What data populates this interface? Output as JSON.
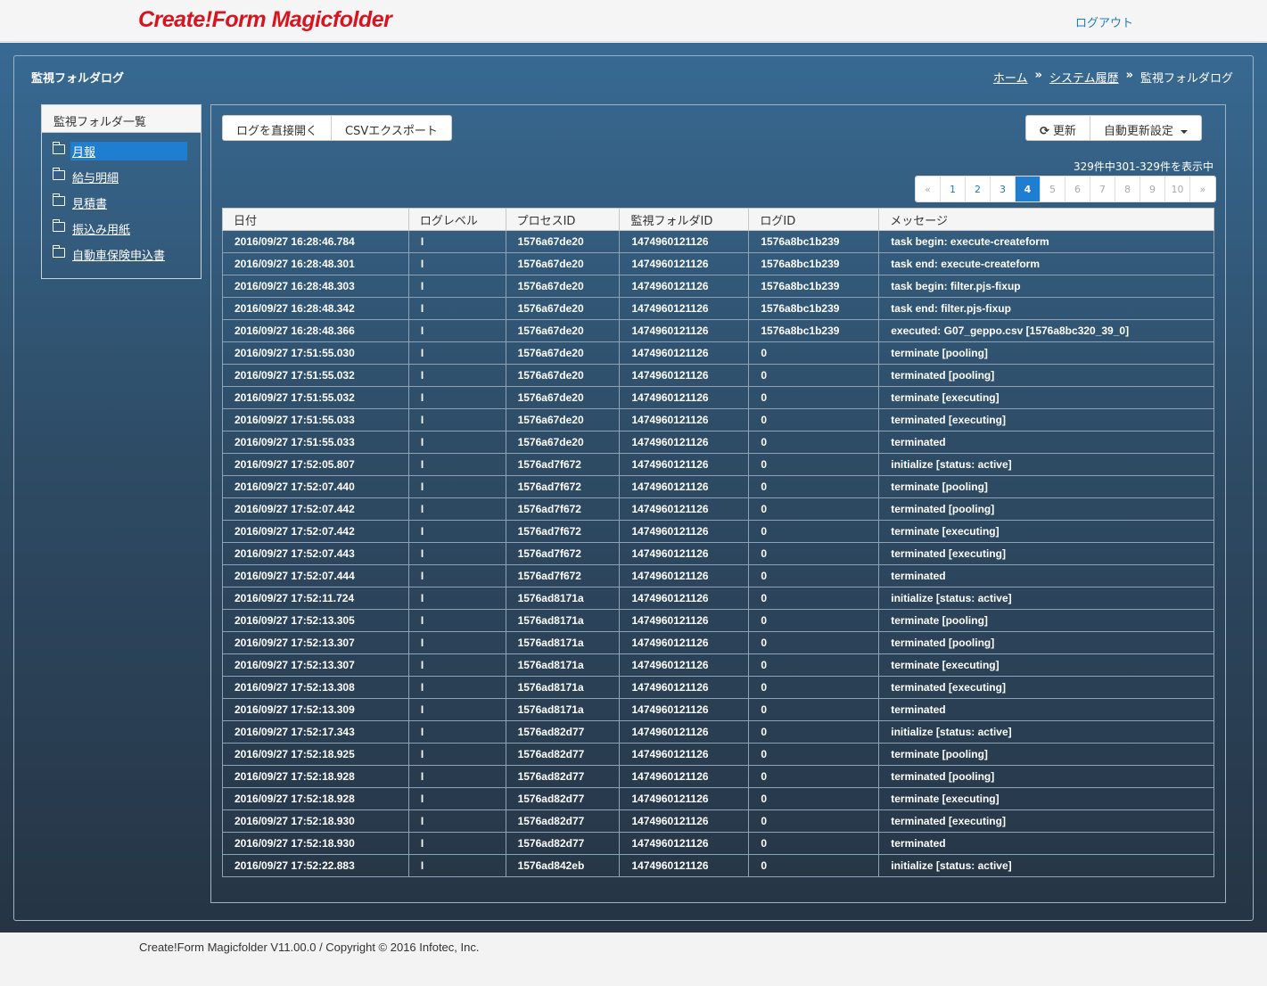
{
  "header": {
    "logo": "Create!Form Magicfolder",
    "logout_label": "ログアウト"
  },
  "page": {
    "title": "監視フォルダログ",
    "breadcrumb": {
      "home": "ホーム",
      "history": "システム履歴",
      "current": "監視フォルダログ",
      "separator": "»"
    }
  },
  "sidebar": {
    "heading": "監視フォルダ一覧",
    "items": [
      {
        "label": "月報",
        "active": true
      },
      {
        "label": "給与明細"
      },
      {
        "label": "見積書"
      },
      {
        "label": "振込み用紙"
      },
      {
        "label": "自動車保険申込書"
      }
    ]
  },
  "toolbar": {
    "open_log_label": "ログを直接開く",
    "csv_export_label": "CSVエクスポート",
    "refresh_label": "更新",
    "auto_refresh_label": "自動更新設定"
  },
  "pagination": {
    "summary": "329件中301-329件を表示中",
    "prev": "«",
    "next": "»",
    "pages": [
      "1",
      "2",
      "3",
      "4",
      "5",
      "6",
      "7",
      "8",
      "9",
      "10"
    ],
    "current": "4"
  },
  "table": {
    "columns": [
      "日付",
      "ログレベル",
      "プロセスID",
      "監視フォルダID",
      "ログID",
      "メッセージ"
    ],
    "rows": [
      [
        "2016/09/27 16:28:46.784",
        "I",
        "1576a67de20",
        "1474960121126",
        "1576a8bc1b239",
        "task begin: execute-createform"
      ],
      [
        "2016/09/27 16:28:48.301",
        "I",
        "1576a67de20",
        "1474960121126",
        "1576a8bc1b239",
        "task end: execute-createform"
      ],
      [
        "2016/09/27 16:28:48.303",
        "I",
        "1576a67de20",
        "1474960121126",
        "1576a8bc1b239",
        "task begin: filter.pjs-fixup"
      ],
      [
        "2016/09/27 16:28:48.342",
        "I",
        "1576a67de20",
        "1474960121126",
        "1576a8bc1b239",
        "task end: filter.pjs-fixup"
      ],
      [
        "2016/09/27 16:28:48.366",
        "I",
        "1576a67de20",
        "1474960121126",
        "1576a8bc1b239",
        "executed: G07_geppo.csv [1576a8bc320_39_0]"
      ],
      [
        "2016/09/27 17:51:55.030",
        "I",
        "1576a67de20",
        "1474960121126",
        "0",
        "terminate [pooling]"
      ],
      [
        "2016/09/27 17:51:55.032",
        "I",
        "1576a67de20",
        "1474960121126",
        "0",
        "terminated [pooling]"
      ],
      [
        "2016/09/27 17:51:55.032",
        "I",
        "1576a67de20",
        "1474960121126",
        "0",
        "terminate [executing]"
      ],
      [
        "2016/09/27 17:51:55.033",
        "I",
        "1576a67de20",
        "1474960121126",
        "0",
        "terminated [executing]"
      ],
      [
        "2016/09/27 17:51:55.033",
        "I",
        "1576a67de20",
        "1474960121126",
        "0",
        "terminated"
      ],
      [
        "2016/09/27 17:52:05.807",
        "I",
        "1576ad7f672",
        "1474960121126",
        "0",
        "initialize [status: active]"
      ],
      [
        "2016/09/27 17:52:07.440",
        "I",
        "1576ad7f672",
        "1474960121126",
        "0",
        "terminate [pooling]"
      ],
      [
        "2016/09/27 17:52:07.442",
        "I",
        "1576ad7f672",
        "1474960121126",
        "0",
        "terminated [pooling]"
      ],
      [
        "2016/09/27 17:52:07.442",
        "I",
        "1576ad7f672",
        "1474960121126",
        "0",
        "terminate [executing]"
      ],
      [
        "2016/09/27 17:52:07.443",
        "I",
        "1576ad7f672",
        "1474960121126",
        "0",
        "terminated [executing]"
      ],
      [
        "2016/09/27 17:52:07.444",
        "I",
        "1576ad7f672",
        "1474960121126",
        "0",
        "terminated"
      ],
      [
        "2016/09/27 17:52:11.724",
        "I",
        "1576ad8171a",
        "1474960121126",
        "0",
        "initialize [status: active]"
      ],
      [
        "2016/09/27 17:52:13.305",
        "I",
        "1576ad8171a",
        "1474960121126",
        "0",
        "terminate [pooling]"
      ],
      [
        "2016/09/27 17:52:13.307",
        "I",
        "1576ad8171a",
        "1474960121126",
        "0",
        "terminated [pooling]"
      ],
      [
        "2016/09/27 17:52:13.307",
        "I",
        "1576ad8171a",
        "1474960121126",
        "0",
        "terminate [executing]"
      ],
      [
        "2016/09/27 17:52:13.308",
        "I",
        "1576ad8171a",
        "1474960121126",
        "0",
        "terminated [executing]"
      ],
      [
        "2016/09/27 17:52:13.309",
        "I",
        "1576ad8171a",
        "1474960121126",
        "0",
        "terminated"
      ],
      [
        "2016/09/27 17:52:17.343",
        "I",
        "1576ad82d77",
        "1474960121126",
        "0",
        "initialize [status: active]"
      ],
      [
        "2016/09/27 17:52:18.925",
        "I",
        "1576ad82d77",
        "1474960121126",
        "0",
        "terminate [pooling]"
      ],
      [
        "2016/09/27 17:52:18.928",
        "I",
        "1576ad82d77",
        "1474960121126",
        "0",
        "terminated [pooling]"
      ],
      [
        "2016/09/27 17:52:18.928",
        "I",
        "1576ad82d77",
        "1474960121126",
        "0",
        "terminate [executing]"
      ],
      [
        "2016/09/27 17:52:18.930",
        "I",
        "1576ad82d77",
        "1474960121126",
        "0",
        "terminated [executing]"
      ],
      [
        "2016/09/27 17:52:18.930",
        "I",
        "1576ad82d77",
        "1474960121126",
        "0",
        "terminated"
      ],
      [
        "2016/09/27 17:52:22.883",
        "I",
        "1576ad842eb",
        "1474960121126",
        "0",
        "initialize [status: active]"
      ]
    ]
  },
  "footer": {
    "text": "Create!Form Magicfolder V11.00.0 / Copyright © 2016 Infotec, Inc."
  },
  "icons": {
    "folder": "folder-open-icon",
    "refresh": "refresh-icon",
    "dropdown": "caret-down-icon"
  },
  "colors": {
    "logo": "#d7141f",
    "accent": "#1f7ed0",
    "band_top": "#386a93",
    "band_bottom": "#263444"
  }
}
